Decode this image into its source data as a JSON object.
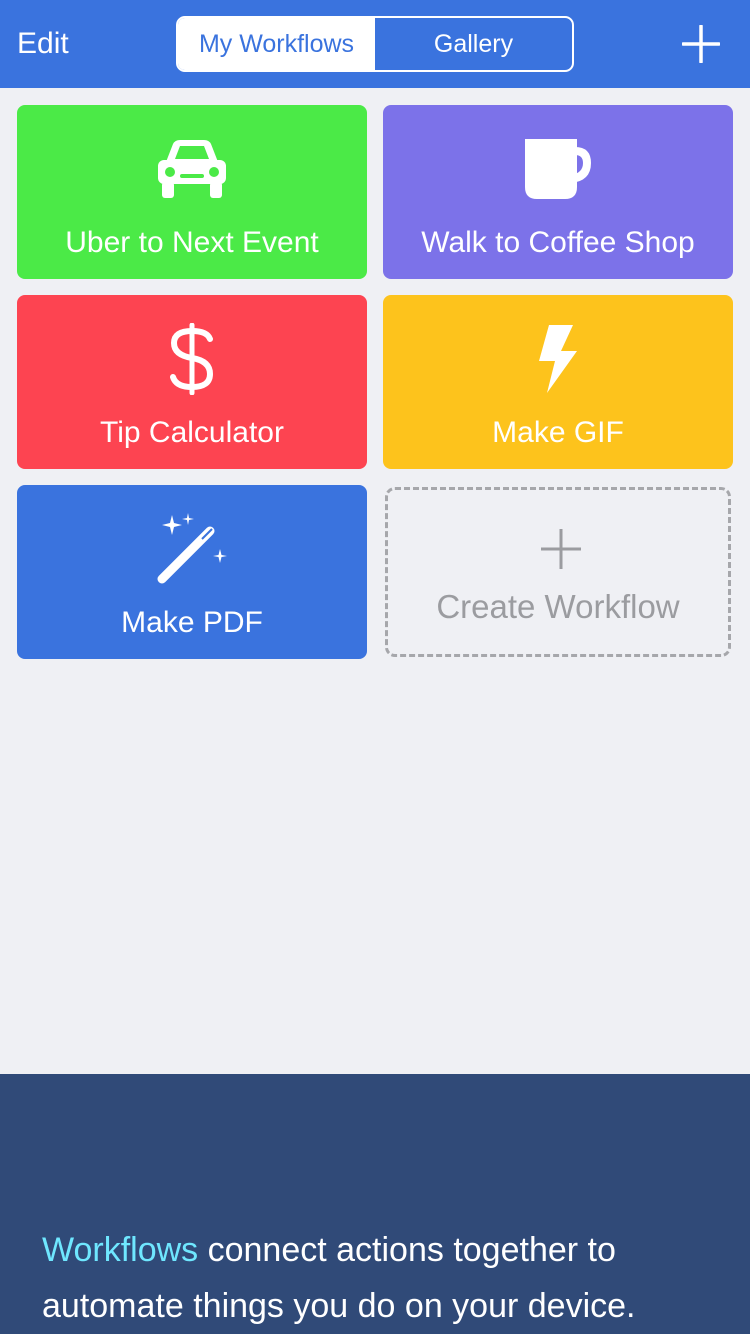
{
  "navbar": {
    "edit_label": "Edit",
    "segments": [
      {
        "label": "My Workflows",
        "selected": true
      },
      {
        "label": "Gallery",
        "selected": false
      }
    ],
    "add_icon": "plus-icon",
    "background": "#3a73de"
  },
  "workflows": [
    {
      "label": "Uber to Next Event",
      "icon": "car-icon",
      "color": "#4bea47"
    },
    {
      "label": "Walk to Coffee Shop",
      "icon": "coffee-mug-icon",
      "color": "#7c72e9"
    },
    {
      "label": "Tip Calculator",
      "icon": "dollar-icon",
      "color": "#fd4451"
    },
    {
      "label": "Make GIF",
      "icon": "lightning-icon",
      "color": "#fdc31c"
    },
    {
      "label": "Make PDF",
      "icon": "magic-wand-icon",
      "color": "#3a73de"
    }
  ],
  "create_tile": {
    "label": "Create Workflow",
    "icon": "plus-icon"
  },
  "footer": {
    "highlight": "Workflows",
    "text": " connect actions together to automate things you do on your device.",
    "background": "#304a78",
    "highlight_color": "#6fe7ff"
  }
}
